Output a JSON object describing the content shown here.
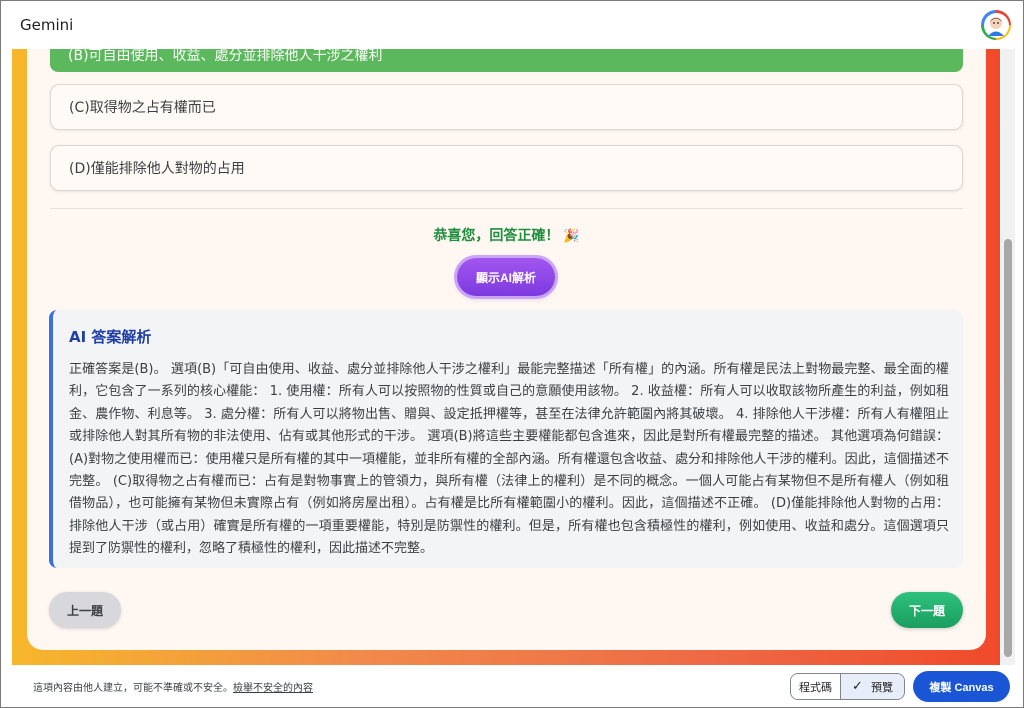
{
  "app": {
    "title": "Gemini"
  },
  "quiz": {
    "correct_option_text": "(B)可自由使用、收益、處分並排除他人干涉之權利",
    "options": [
      {
        "label": "(C)取得物之占有權而已"
      },
      {
        "label": "(D)僅能排除他人對物的占用"
      }
    ],
    "congrats": "恭喜您，回答正確！",
    "party_icon": "party-popper-icon",
    "ai_button_label": "顯示AI解析",
    "analysis": {
      "title": "AI 答案解析",
      "body": "正確答案是(B)。 選項(B)「可自由使用、收益、處分並排除他人干涉之權利」最能完整描述「所有權」的內涵。所有權是民法上對物最完整、最全面的權利，它包含了一系列的核心權能： 1. 使用權：所有人可以按照物的性質或自己的意願使用該物。 2. 收益權：所有人可以收取該物所產生的利益，例如租金、農作物、利息等。 3. 處分權：所有人可以將物出售、贈與、設定抵押權等，甚至在法律允許範圍內將其破壞。 4. 排除他人干涉權：所有人有權阻止或排除他人對其所有物的非法使用、佔有或其他形式的干涉。 選項(B)將這些主要權能都包含進來，因此是對所有權最完整的描述。 其他選項為何錯誤： (A)對物之使用權而已：使用權只是所有權的其中一項權能，並非所有權的全部內涵。所有權還包含收益、處分和排除他人干涉的權利。因此，這個描述不完整。 (C)取得物之占有權而已：占有是對物事實上的管領力，與所有權（法律上的權利）是不同的概念。一個人可能占有某物但不是所有權人（例如租借物品），也可能擁有某物但未實際占有（例如將房屋出租）。占有權是比所有權範圍小的權利。因此，這個描述不正確。 (D)僅能排除他人對物的占用：排除他人干涉（或占用）確實是所有權的一項重要權能，特別是防禦性的權利。但是，所有權也包含積極性的權利，例如使用、收益和處分。這個選項只提到了防禦性的權利，忽略了積極性的權利，因此描述不完整。"
    },
    "prev_label": "上一題",
    "next_label": "下一題"
  },
  "footer": {
    "disclaimer": "這項內容由他人建立，可能不準確或不安全。",
    "report_link": "檢舉不安全的內容",
    "code_label": "程式碼",
    "preview_label": "預覽",
    "copy_canvas_label": "複製 Canvas"
  },
  "colors": {
    "correct_green": "#5cb85c",
    "accent_purple": "#8b45e8",
    "next_green": "#1fae6a",
    "analysis_border": "#3b6fe0",
    "canvas_blue": "#1a55d6"
  }
}
